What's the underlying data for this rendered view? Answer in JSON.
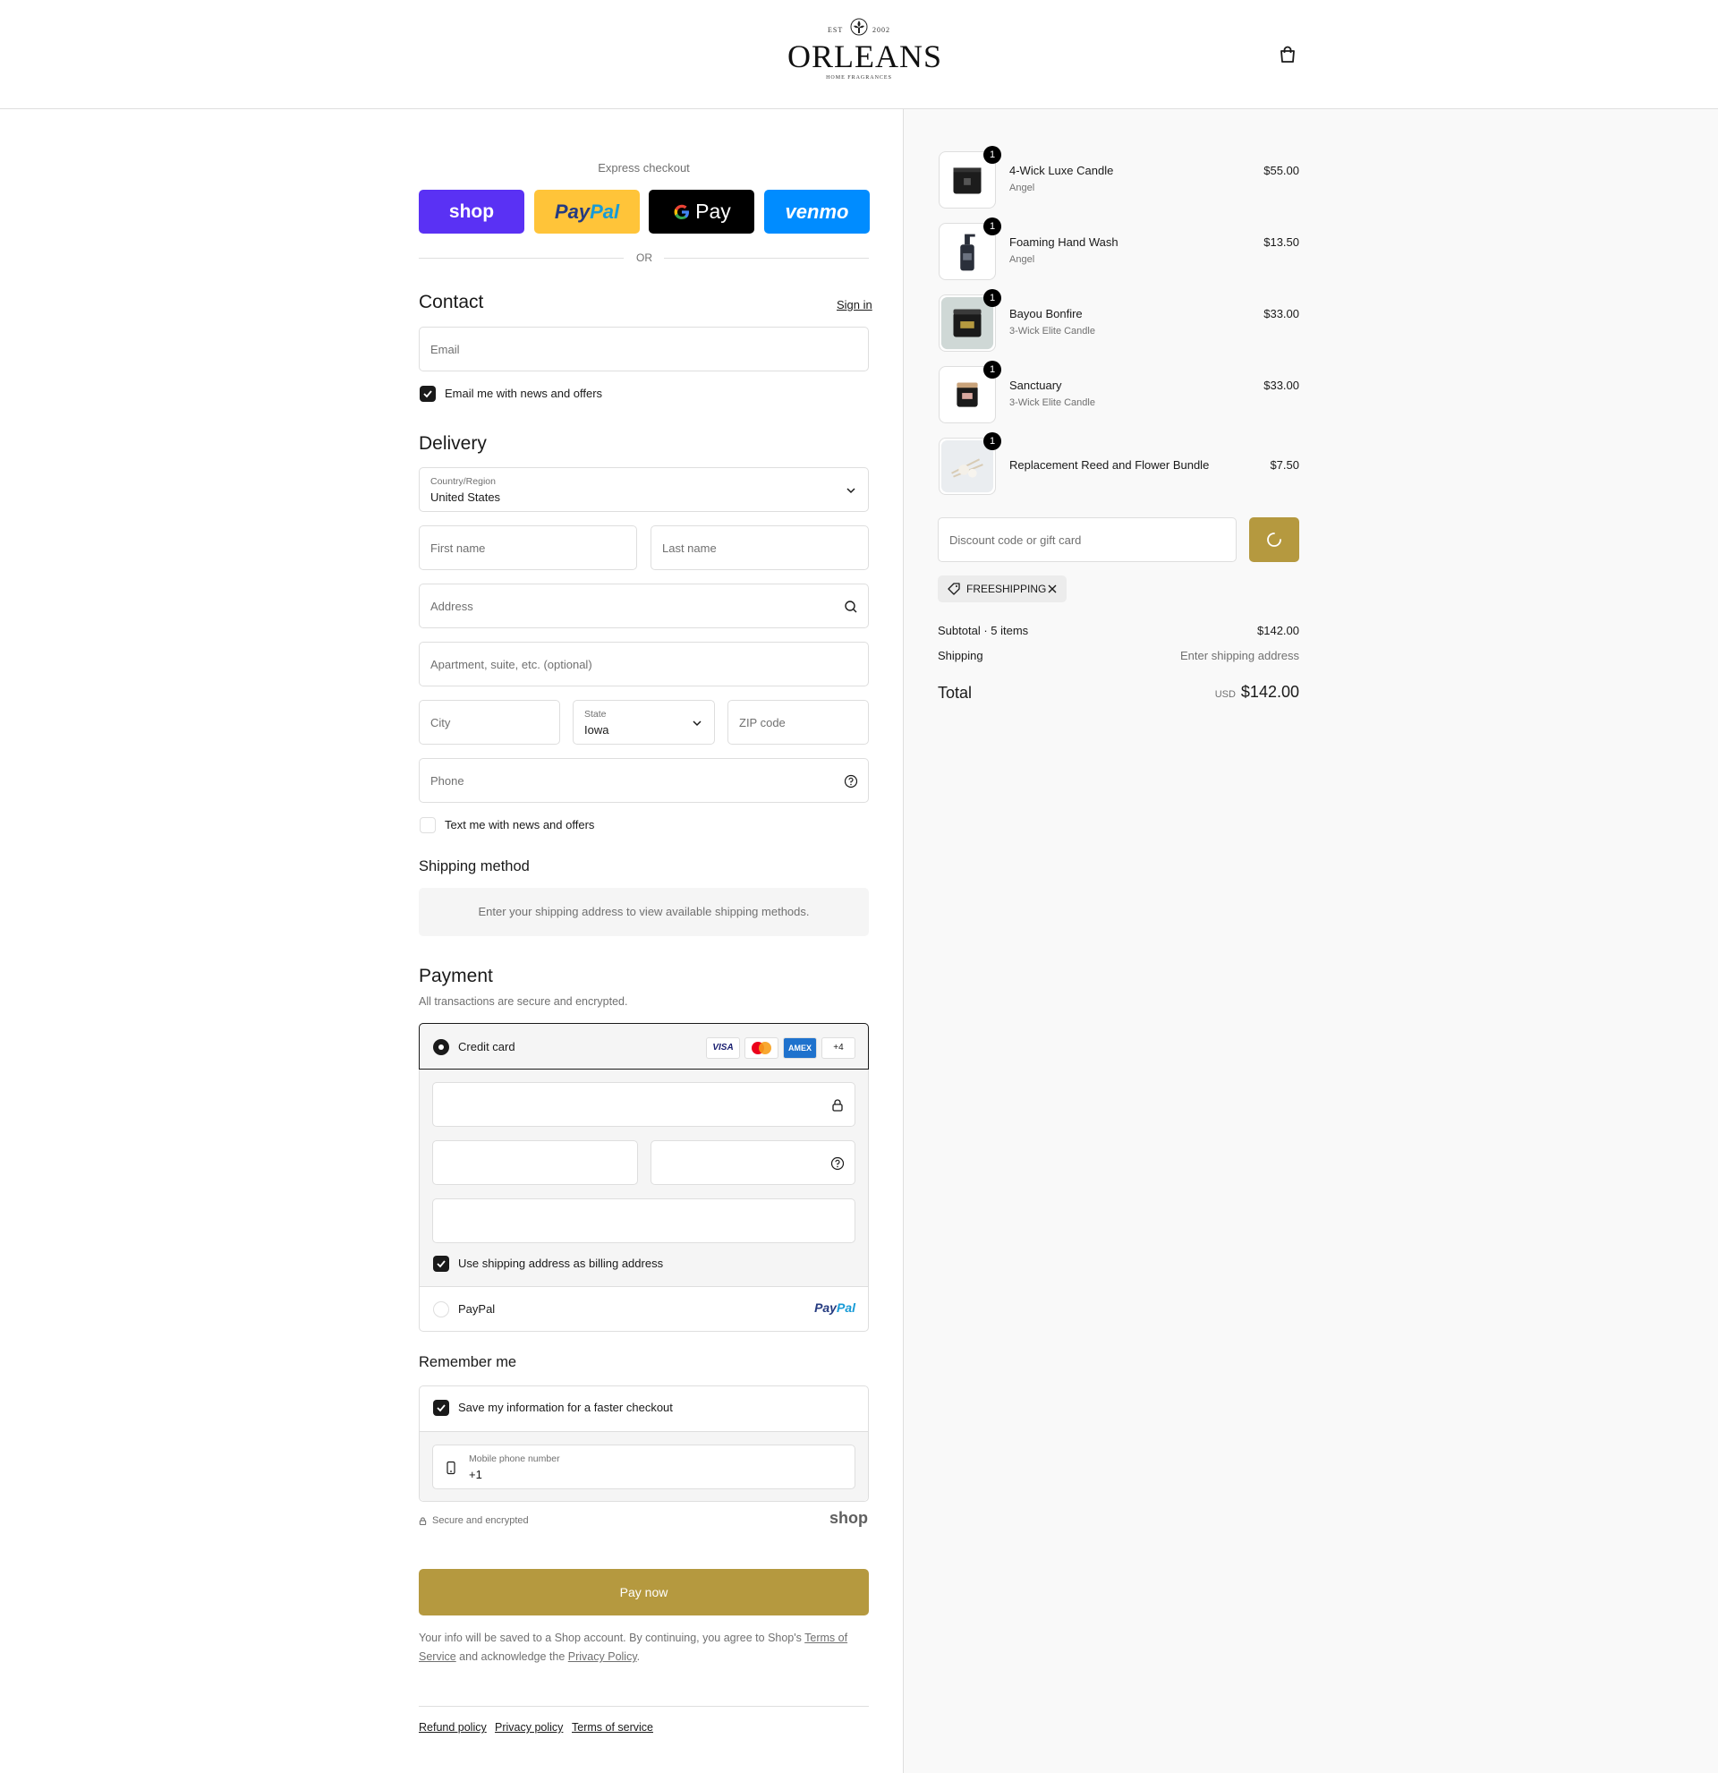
{
  "header": {
    "logo": {
      "est_left": "EST",
      "est_right": "2002",
      "name": "ORLEANS",
      "sub": "HOME FRAGRANCES"
    }
  },
  "express": {
    "title": "Express checkout",
    "shop_label": "shop",
    "paypal_label_a": "Pay",
    "paypal_label_b": "Pal",
    "gpay_label": "Pay",
    "venmo_label": "venmo",
    "or_label": "OR"
  },
  "contact": {
    "title": "Contact",
    "sign_in": "Sign in",
    "email_placeholder": "Email",
    "news_label": "Email me with news and offers"
  },
  "delivery": {
    "title": "Delivery",
    "country_label": "Country/Region",
    "country_value": "United States",
    "first_name": "First name",
    "last_name": "Last name",
    "address": "Address",
    "apartment": "Apartment, suite, etc. (optional)",
    "city": "City",
    "state_label": "State",
    "state_value": "Iowa",
    "zip": "ZIP code",
    "phone": "Phone",
    "text_offers": "Text me with news and offers"
  },
  "shipping_method": {
    "title": "Shipping method",
    "message": "Enter your shipping address to view available shipping methods."
  },
  "payment": {
    "title": "Payment",
    "subtitle": "All transactions are secure and encrypted.",
    "credit_card": "Credit card",
    "brands": [
      "VISA",
      "AMEX",
      "+4"
    ],
    "billing_label": "Use shipping address as billing address",
    "paypal": "PayPal",
    "paypal_logo_a": "Pay",
    "paypal_logo_b": "Pal"
  },
  "remember": {
    "title": "Remember me",
    "save_label": "Save my information for a faster checkout",
    "mobile_label": "Mobile phone number",
    "mobile_value": "+1",
    "secure": "Secure and encrypted",
    "shop_logo": "shop"
  },
  "pay_now": "Pay now",
  "legal": {
    "text1": "Your info will be saved to a Shop account. By continuing, you agree to Shop's ",
    "terms": "Terms of Service",
    "text2": " and acknowledge the ",
    "privacy": "Privacy Policy",
    "text3": "."
  },
  "footer": {
    "links": [
      "Refund policy",
      "Privacy policy",
      "Terms of service"
    ]
  },
  "order": {
    "items": [
      {
        "name": "4-Wick Luxe Candle",
        "variant": "Angel",
        "price": "$55.00",
        "qty": "1"
      },
      {
        "name": "Foaming Hand Wash",
        "variant": "Angel",
        "price": "$13.50",
        "qty": "1"
      },
      {
        "name": "Bayou Bonfire",
        "variant": "3-Wick Elite Candle",
        "price": "$33.00",
        "qty": "1"
      },
      {
        "name": "Sanctuary",
        "variant": "3-Wick Elite Candle",
        "price": "$33.00",
        "qty": "1"
      },
      {
        "name": "Replacement Reed and Flower Bundle",
        "variant": "",
        "price": "$7.50",
        "qty": "1"
      }
    ],
    "discount_placeholder": "Discount code or gift card",
    "code": "FREESHIPPING",
    "subtotal_label": "Subtotal · 5 items",
    "subtotal_value": "$142.00",
    "shipping_label": "Shipping",
    "shipping_value": "Enter shipping address",
    "total_label": "Total",
    "currency": "USD",
    "total_value": "$142.00"
  },
  "colors": {
    "accent": "#b5993f",
    "shop": "#5a31f4",
    "paypal": "#ffc439",
    "venmo": "#008cff"
  }
}
